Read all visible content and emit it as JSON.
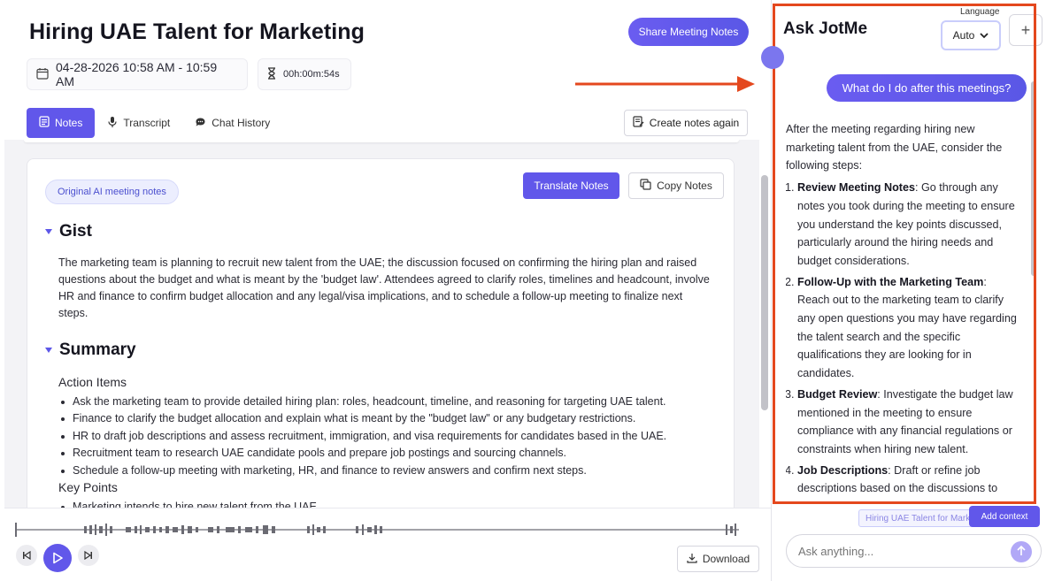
{
  "header": {
    "title": "Hiring UAE Talent for Marketing",
    "share_label": "Share Meeting Notes",
    "date_range": "04-28-2026 10:58 AM - 10:59 AM",
    "duration": "00h:00m:54s"
  },
  "tabs": [
    {
      "label": "Notes",
      "icon": "notes-icon"
    },
    {
      "label": "Transcript",
      "icon": "mic-icon"
    },
    {
      "label": "Chat History",
      "icon": "chat-icon"
    }
  ],
  "create_notes_again_label": "Create notes again",
  "notes": {
    "original_chip": "Original AI meeting notes",
    "translate_label": "Translate Notes",
    "copy_label": "Copy Notes",
    "gist_heading": "Gist",
    "gist_text": "The marketing team is planning to recruit new talent from the UAE; the discussion focused on confirming the hiring plan and raised questions about the budget and what is meant by the 'budget law'. Attendees agreed to clarify roles, timelines and headcount, involve HR and finance to confirm budget allocation and any legal/visa implications, and to schedule a follow-up meeting to finalize next steps.",
    "summary_heading": "Summary",
    "action_items_label": "Action Items",
    "action_items": [
      "Ask the marketing team to provide detailed hiring plan: roles, headcount, timeline, and reasoning for targeting UAE talent.",
      "Finance to clarify the budget allocation and explain what is meant by the \"budget law\" or any budgetary restrictions.",
      "HR to draft job descriptions and assess recruitment, immigration, and visa requirements for candidates based in the UAE.",
      "Recruitment team to research UAE candidate pools and prepare job postings and sourcing channels.",
      "Schedule a follow-up meeting with marketing, HR, and finance to review answers and confirm next steps."
    ],
    "key_points_label": "Key Points",
    "key_points": [
      "Marketing intends to hire new talent from the UAE."
    ]
  },
  "player": {
    "download_label": "Download"
  },
  "chat": {
    "title": "Ask JotMe",
    "language_label": "Language",
    "language_value": "Auto",
    "user_question": "What do I do after this meetings?",
    "answer_intro": "After the meeting regarding hiring new marketing talent from the UAE, consider the following steps:",
    "steps": [
      {
        "title": "Review Meeting Notes",
        "text": ": Go through any notes you took during the meeting to ensure you understand the key points discussed, particularly around the hiring needs and budget considerations."
      },
      {
        "title": "Follow-Up with the Marketing Team",
        "text": ": Reach out to the marketing team to clarify any open questions you may have regarding the talent search and the specific qualifications they are looking for in candidates."
      },
      {
        "title": "Budget Review",
        "text": ": Investigate the budget law mentioned in the meeting to ensure compliance with any financial regulations or constraints when hiring new talent."
      },
      {
        "title": "Job Descriptions",
        "text": ": Draft or refine job descriptions based on the discussions to"
      }
    ],
    "context_chip": "Hiring UAE Talent for Marketing",
    "add_context_label": "Add context",
    "input_placeholder": "Ask anything..."
  },
  "colors": {
    "accent": "#6157ea",
    "highlight_box": "#e4481e"
  }
}
